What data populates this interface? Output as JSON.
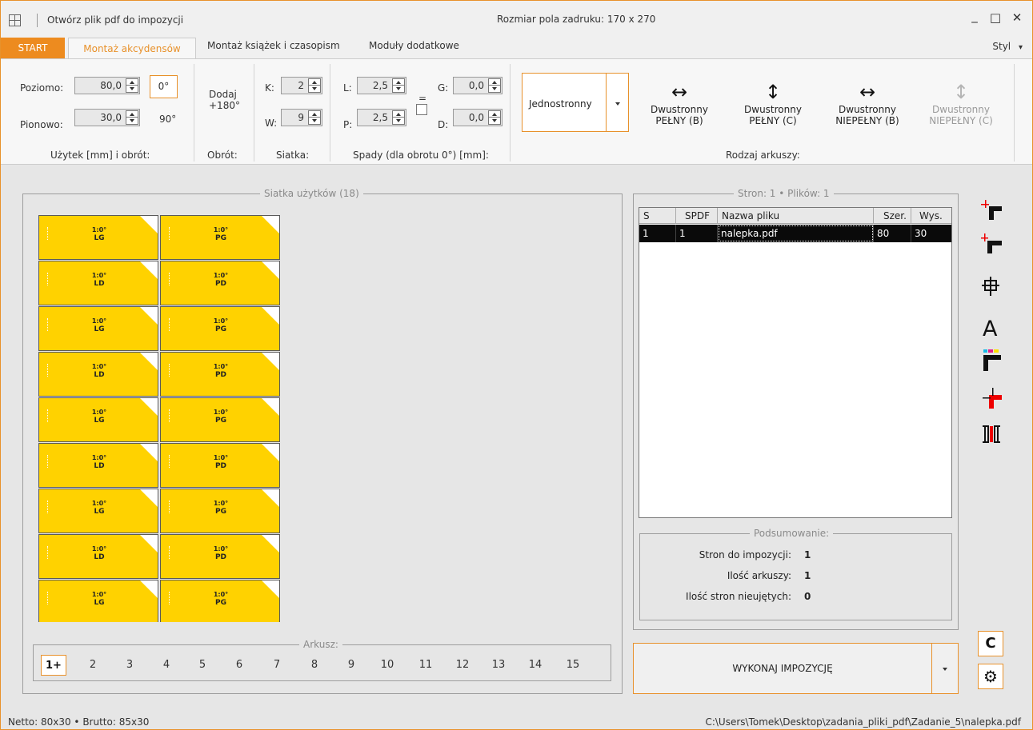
{
  "titlebar": {
    "open_file": "Otwórz plik pdf do impozycji",
    "print_area": "Rozmiar pola zadruku: 170 x 270",
    "minimize": "_",
    "maximize": "□",
    "close": "✕"
  },
  "tabs": {
    "start": "START",
    "items": [
      "Montaż akcydensów",
      "Montaż książek i czasopism",
      "Moduły dodatkowe"
    ],
    "style": "Styl",
    "style_arrow": "▾"
  },
  "ribbon": {
    "horizontal_label": "Poziomo:",
    "horizontal_value": "80,0",
    "vertical_label": "Pionowo:",
    "vertical_value": "30,0",
    "rot0": "0°",
    "rot90": "90°",
    "group1_label": "Użytek [mm] i obrót:",
    "add180_line1": "Dodaj",
    "add180_line2": "+180°",
    "group2_label": "Obrót:",
    "k_label": "K:",
    "k_value": "2",
    "w_label": "W:",
    "w_value": "9",
    "group3_label": "Siatka:",
    "l_label": "L:",
    "l_value": "2,5",
    "p_label": "P:",
    "p_value": "2,5",
    "eq": "=",
    "g_label": "G:",
    "g_value": "0,0",
    "d_label": "D:",
    "d_value": "0,0",
    "group4_label": "Spady (dla obrotu 0°) [mm]:",
    "sided_value": "Jednostronny",
    "sheet_types": [
      {
        "line1": "Dwustronny",
        "line2": "PEŁNY (B)",
        "icon": "↔",
        "enabled": true
      },
      {
        "line1": "Dwustronny",
        "line2": "PEŁNY (C)",
        "icon": "↕",
        "enabled": true
      },
      {
        "line1": "Dwustronny",
        "line2": "NIEPEŁNY (B)",
        "icon": "↔",
        "enabled": true
      },
      {
        "line1": "Dwustronny",
        "line2": "NIEPEŁNY (C)",
        "icon": "↕",
        "enabled": false
      }
    ],
    "group5_label": "Rodzaj arkuszy:"
  },
  "grid": {
    "title": "Siatka użytków (18)",
    "tiles": [
      {
        "t1": "1:0°",
        "t2": "LG"
      },
      {
        "t1": "1:0°",
        "t2": "PG"
      },
      {
        "t1": "1:0°",
        "t2": "LD"
      },
      {
        "t1": "1:0°",
        "t2": "PD"
      },
      {
        "t1": "1:0°",
        "t2": "LG"
      },
      {
        "t1": "1:0°",
        "t2": "PG"
      },
      {
        "t1": "1:0°",
        "t2": "LD"
      },
      {
        "t1": "1:0°",
        "t2": "PD"
      },
      {
        "t1": "1:0°",
        "t2": "LG"
      },
      {
        "t1": "1:0°",
        "t2": "PG"
      },
      {
        "t1": "1:0°",
        "t2": "LD"
      },
      {
        "t1": "1:0°",
        "t2": "PD"
      },
      {
        "t1": "1:0°",
        "t2": "LG"
      },
      {
        "t1": "1:0°",
        "t2": "PG"
      },
      {
        "t1": "1:0°",
        "t2": "LD"
      },
      {
        "t1": "1:0°",
        "t2": "PD"
      },
      {
        "t1": "1:0°",
        "t2": "LG"
      },
      {
        "t1": "1:0°",
        "t2": "PG"
      }
    ]
  },
  "sheets": {
    "title": "Arkusz:",
    "pages": [
      "1+",
      "2",
      "3",
      "4",
      "5",
      "6",
      "7",
      "8",
      "9",
      "10",
      "11",
      "12",
      "13",
      "14",
      "15"
    ],
    "active_index": 0
  },
  "files": {
    "title": "Stron: 1 • Plików: 1",
    "columns": [
      "S",
      "SPDF",
      "Nazwa pliku",
      "Szer.",
      "Wys."
    ],
    "rows": [
      [
        "1",
        "1",
        "nalepka.pdf",
        "80",
        "30"
      ]
    ]
  },
  "summary": {
    "title": "Podsumowanie:",
    "rows": [
      {
        "label": "Stron do impozycji:",
        "value": "1"
      },
      {
        "label": "Ilość arkuszy:",
        "value": "1"
      },
      {
        "label": "Ilość stron nieujętych:",
        "value": "0"
      }
    ]
  },
  "execute": {
    "label": "WYKONAJ IMPOZYCJĘ"
  },
  "side": {
    "c_label": "C",
    "gear": "⚙"
  },
  "status": {
    "left": "Netto: 80x30 • Brutto: 85x30",
    "right": "C:\\Users\\Tomek\\Desktop\\zadania_pliki_pdf\\Zadanie_5\\nalepka.pdf"
  },
  "colors": {
    "accent": "#e8912b",
    "tile": "#ffd200",
    "selection": "#0a0a0a"
  }
}
